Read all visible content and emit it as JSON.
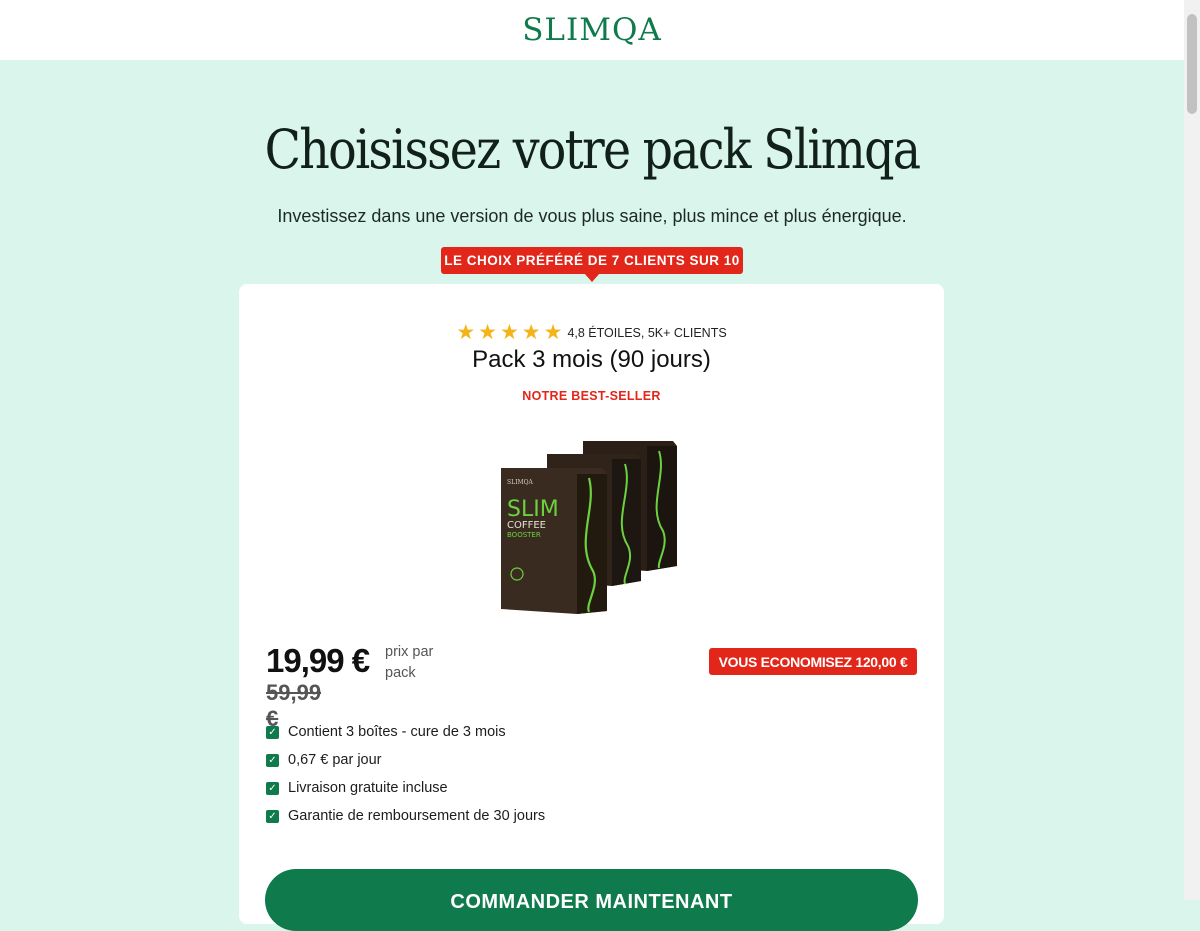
{
  "header": {
    "logo": "SLIMQA"
  },
  "hero": {
    "title": "Choisissez votre pack Slimqa",
    "subtitle": "Investissez dans une version de vous plus saine, plus mince et plus énergique."
  },
  "ribbon": {
    "label": "LE CHOIX PRÉFÉRÉ DE 7 CLIENTS SUR 10"
  },
  "card": {
    "rating": {
      "stars": 5,
      "text": "4,8 ÉTOILES, 5K+ CLIENTS"
    },
    "title": "Pack 3 mois (90 jours)",
    "badge": "NOTRE BEST-SELLER",
    "product": {
      "brand": "SLIMQA",
      "name_line1": "SLIM",
      "name_line2": "COFFEE",
      "name_line3": "BOOSTER"
    },
    "price": {
      "current": "19,99 €",
      "unit": "prix par pack",
      "old": "59,99 €"
    },
    "savings": "VOUS ECONOMISEZ 120,00 €",
    "features": [
      "Contient 3 boîtes - cure de 3 mois",
      "0,67 € par jour",
      "Livraison gratuite incluse",
      "Garantie de remboursement de 30 jours"
    ],
    "cta": "COMMANDER MAINTENANT"
  },
  "colors": {
    "brand_green": "#0f7a4c",
    "accent_red": "#e2261a",
    "page_bg": "#daf5ec",
    "star": "#f4b419"
  },
  "icons": {
    "star": "star-icon",
    "check": "checkbox-checked-icon"
  }
}
